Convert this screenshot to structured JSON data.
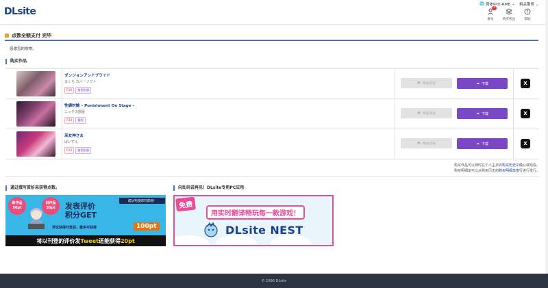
{
  "header": {
    "logo": "DLsite",
    "language": "简体中文-RMB",
    "support": "相关服务",
    "icons": [
      {
        "name": "user-icon",
        "label": "账号",
        "badge": "1"
      },
      {
        "name": "library-icon",
        "label": "购买作品"
      },
      {
        "name": "help-icon",
        "label": "帮助"
      }
    ]
  },
  "page": {
    "title": "点数全额支付 完毕",
    "thanks": "感谢您的购物。",
    "purchased_heading": "购买作品"
  },
  "products": [
    {
      "title": "ダンジョンアンドプライド",
      "maker": "まくら カバーソフト",
      "tags": [
        {
          "text": "R18",
          "kind": "pink"
        },
        {
          "text": "角色扮演",
          "kind": "purple"
        }
      ],
      "view_label": "网站浏览",
      "download_label": "下载",
      "share_label": "X"
    },
    {
      "title": "性癖討論 – Punishment On Stage –",
      "maker": "ニッチの部屋",
      "tags": [
        {
          "text": "R18",
          "kind": "pink"
        },
        {
          "text": "冒险",
          "kind": "purple"
        }
      ],
      "view_label": "网站浏览",
      "download_label": "下载",
      "share_label": "X"
    },
    {
      "title": "巫女神さま",
      "maker": "ぱいずん",
      "tags": [
        {
          "text": "R18",
          "kind": "pink"
        },
        {
          "text": "角色扮演",
          "kind": "purple"
        }
      ],
      "view_label": "网站浏览",
      "download_label": "下载",
      "share_label": "X"
    }
  ],
  "notes": {
    "line1_a": "购买作品可以随时在个人主页的",
    "line1_link": "购买历史",
    "line1_b": "中确认或观看。",
    "line2_a": "购买明细单可以从购买历史的",
    "line2_link": "购买明细单发行",
    "line2_b": "进行发行。"
  },
  "banners": {
    "review_heading": "通过撰写赏析来获得点数。",
    "review": {
      "badge1": "新作品 50pt",
      "badge2": "旧作品 50pt",
      "main1": "发表评价",
      "main2": "积分GET",
      "pill": "成功刊登即可得到！",
      "sub": "评论获得刊登后，最多可获得",
      "amount": "100pt",
      "bottom_a": "将以刊登的评价发",
      "bottom_hl1": "Tweet",
      "bottom_b": "还能获得",
      "bottom_hl2": "20pt"
    },
    "nest_heading": "向乱码说再见！DLsite专用PC应用",
    "nest": {
      "free": "免费",
      "top": "用实时翻译畅玩每一款游戏！",
      "logo": "DLsite NEST"
    }
  },
  "footer": {
    "copyright": "© 1996 DLsite"
  },
  "colors": {
    "brand": "#1d3f8c",
    "download": "#7948c2",
    "accent": "#e7a52a",
    "footer": "#2c3341"
  }
}
